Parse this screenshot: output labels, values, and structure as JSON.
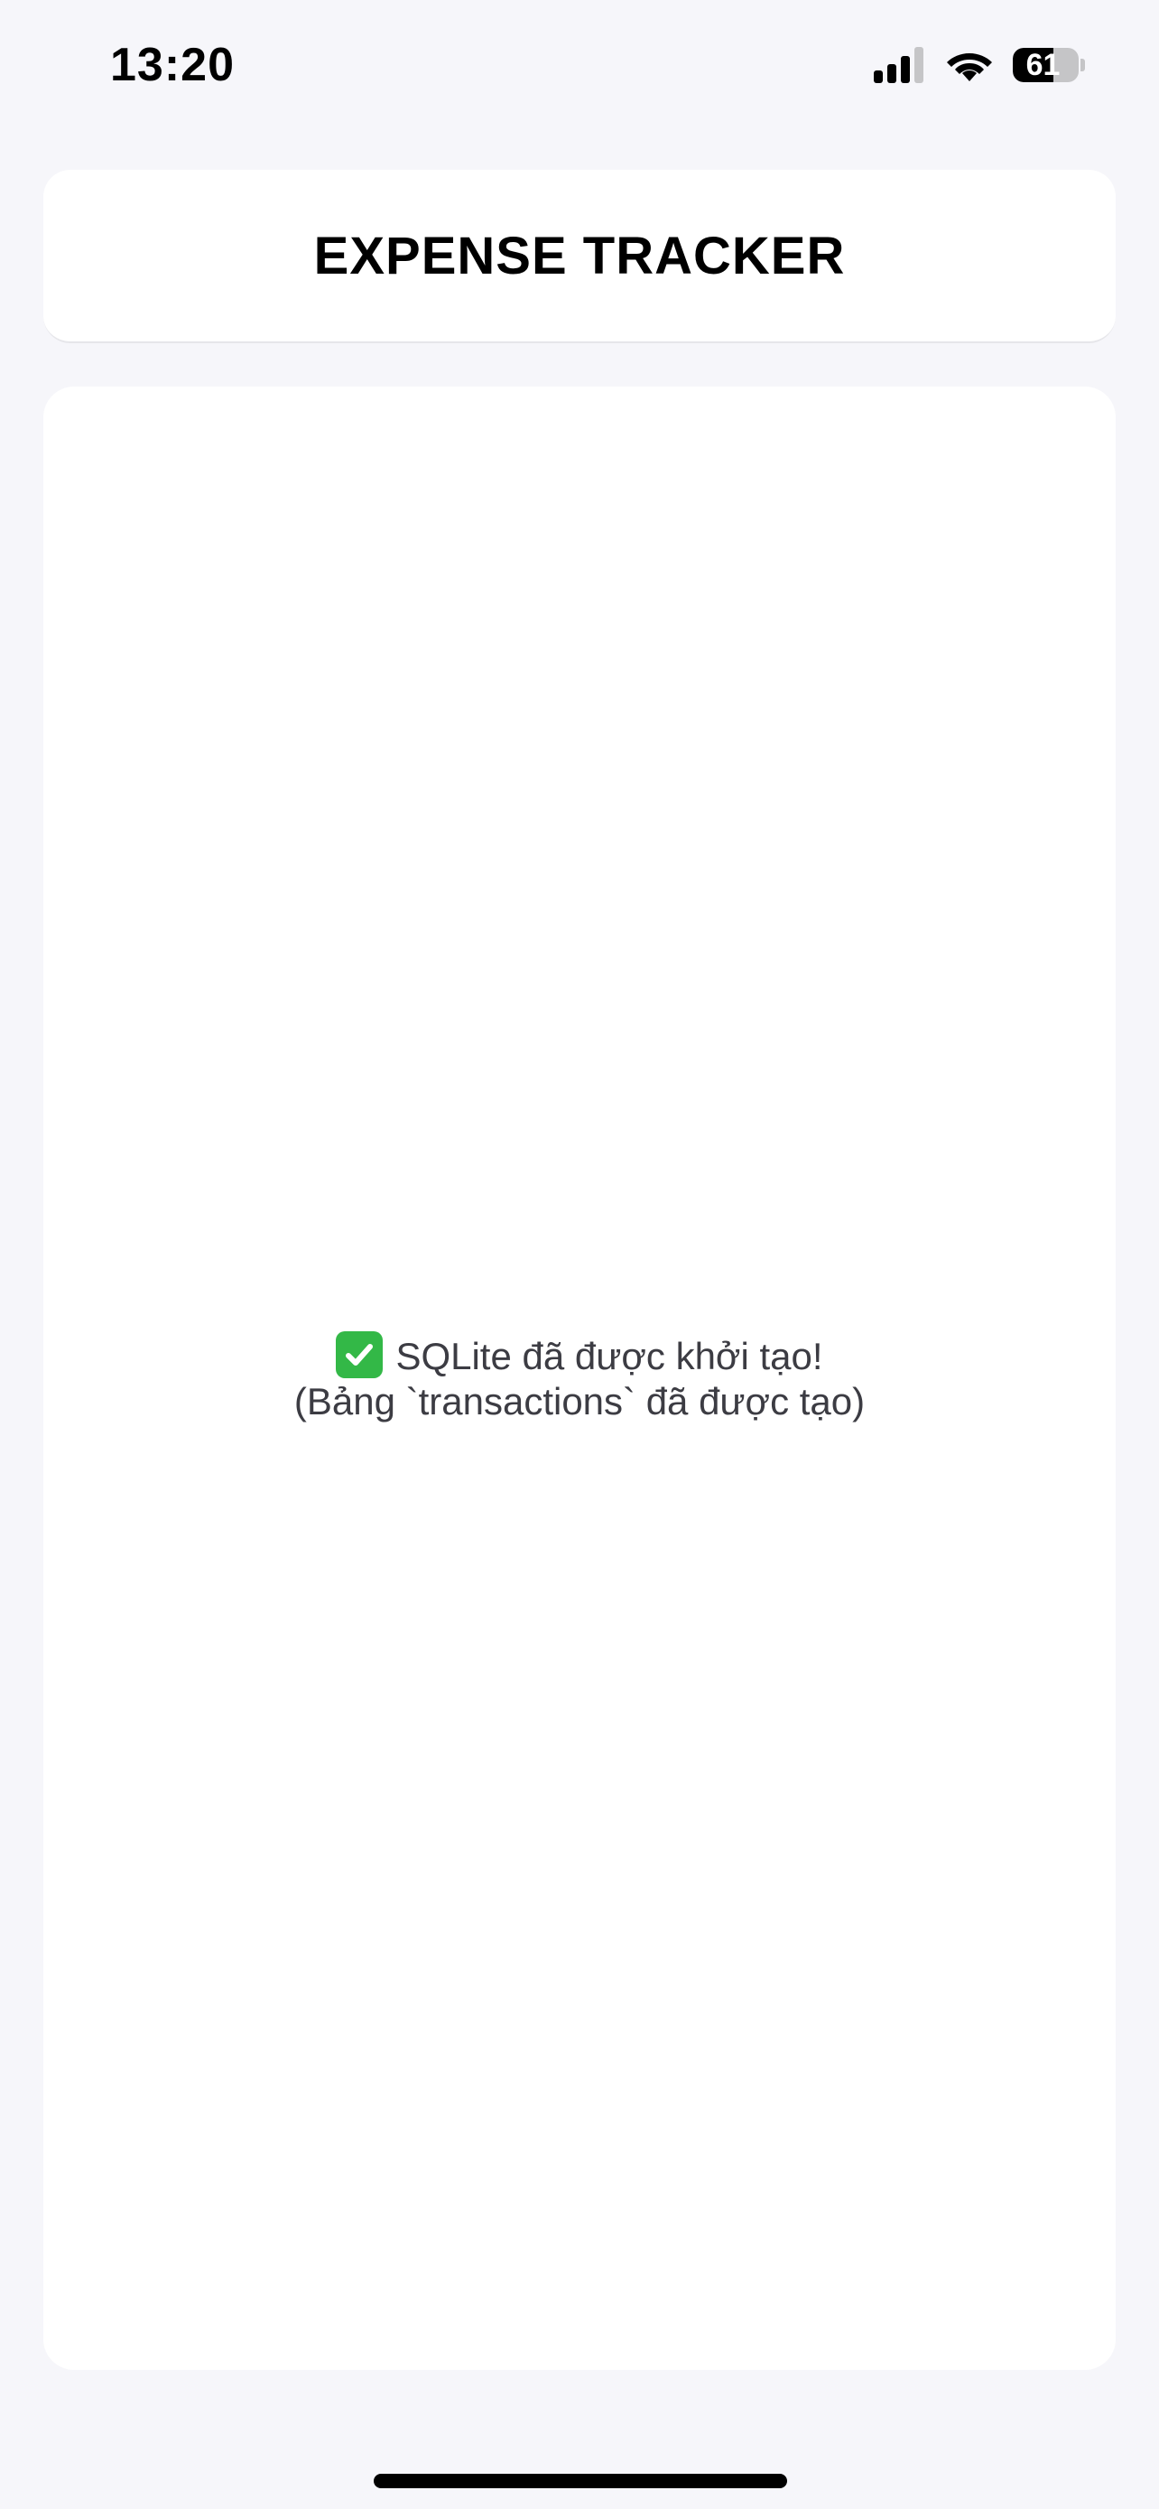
{
  "status_bar": {
    "time": "13:20",
    "battery_percent": "61",
    "battery_level": 0.61,
    "icons": [
      "signal-icon",
      "wifi-icon",
      "battery-icon"
    ]
  },
  "header": {
    "title": "EXPENSE TRACKER"
  },
  "content": {
    "message_icon": "check-mark-icon",
    "message_line1": "SQLite đã được khởi tạo!",
    "message_line2": "(Bảng `transactions` đã được tạo)"
  },
  "colors": {
    "background": "#F6F6FA",
    "card": "#FFFFFF",
    "check_green": "#33B847",
    "text_secondary": "#3C3C43"
  }
}
